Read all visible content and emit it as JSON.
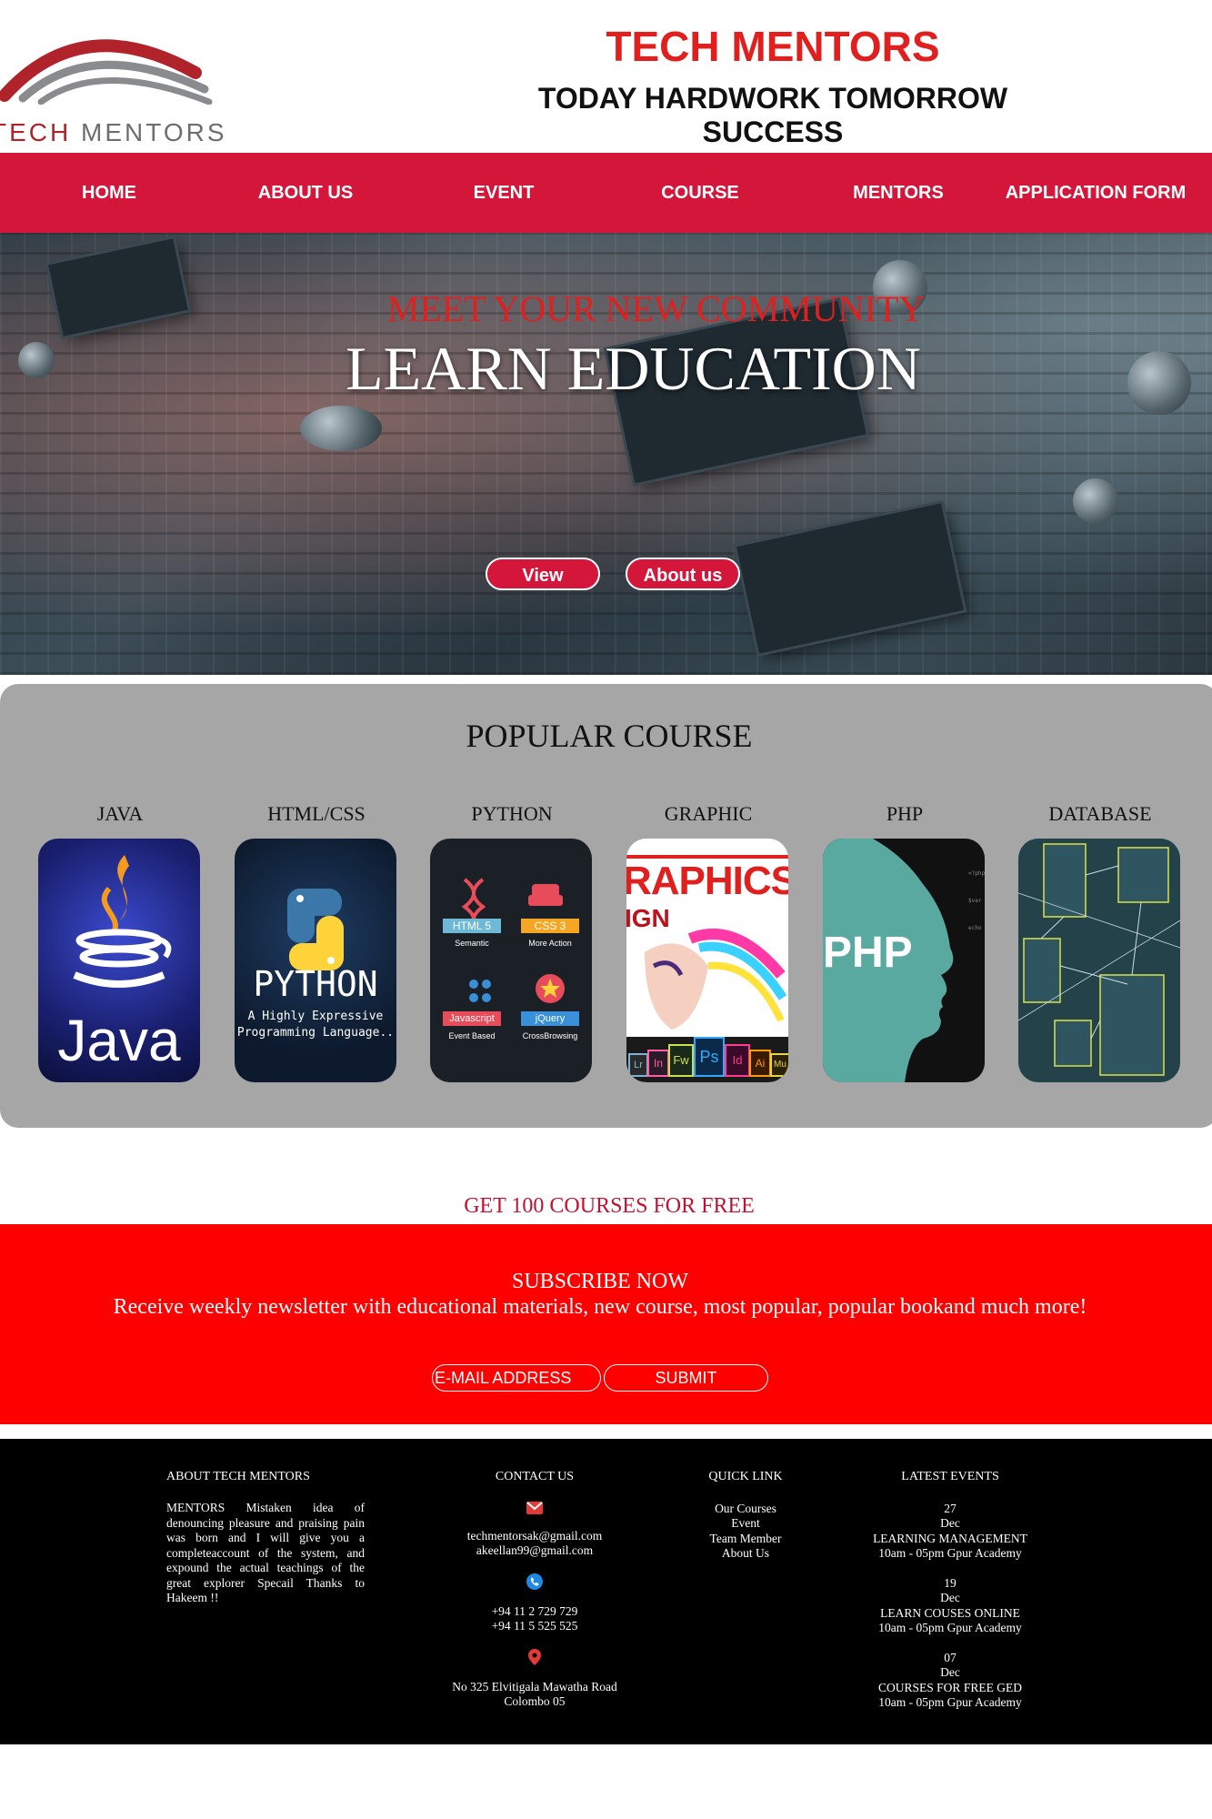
{
  "header": {
    "logo_text_accent": "TECH",
    "logo_text_rest": "MENTORS",
    "title": "TECH MENTORS",
    "tagline": "TODAY HARDWORK TOMORROW SUCCESS"
  },
  "nav": {
    "items": [
      "HOME",
      "ABOUT US",
      "EVENT",
      "COURSE",
      "MENTORS",
      "APPLICATION FORM"
    ]
  },
  "hero": {
    "subtitle": "MEET YOUR NEW COMMUNITY",
    "title": "LEARN EDUCATION",
    "buttons": [
      "View",
      "About us"
    ]
  },
  "popular": {
    "title": "POPULAR COURSE",
    "courses": [
      {
        "label": "JAVA",
        "card_text": "Java"
      },
      {
        "label": "HTML/CSS",
        "card_text": "PYTHON",
        "card_sub1": "A Highly Expressive",
        "card_sub2": "Programming Language.."
      },
      {
        "label": "PYTHON",
        "tiles": [
          "HTML 5",
          "CSS 3",
          "Javascript",
          "jQuery"
        ],
        "tile_subs": [
          "Semantic",
          "More Action",
          "Event Based",
          "CrossBrowsing"
        ]
      },
      {
        "label": "GRAPHIC",
        "card_text": "RAPHICS",
        "card_sub": "IGN",
        "app_icons": [
          "Lr",
          "In",
          "Fw",
          "Ps",
          "Id",
          "Ai",
          "Mu"
        ]
      },
      {
        "label": "PHP",
        "card_text": "PHP"
      },
      {
        "label": "DATABASE"
      }
    ]
  },
  "free_text": "GET 100 COURSES FOR FREE",
  "subscribe": {
    "title": "SUBSCRIBE NOW",
    "text": "Receive weekly newsletter with educational materials, new course, most popular, popular bookand much more!",
    "email_placeholder": "E-MAIL ADDRESS",
    "submit_label": "SUBMIT"
  },
  "footer": {
    "about": {
      "heading": "ABOUT TECH MENTORS",
      "text": "MENTORS Mistaken idea of denouncing pleasure and praising pain was born and I will give you a completeaccount of the system, and expound the actual teachings of the great explorer Specail Thanks to Hakeem !!"
    },
    "contact": {
      "heading": "CONTACT US",
      "emails": [
        "techmentorsak@gmail.com",
        "akeellan99@gmail.com"
      ],
      "phones": [
        "+94 11 2 729 729",
        "+94 11 5 525 525"
      ],
      "address": [
        "No 325 Elvitigala Mawatha Road",
        "Colombo 05"
      ]
    },
    "quick_links": {
      "heading": "QUICK LINK",
      "items": [
        "Our Courses",
        "Event",
        "Team Member",
        "About Us"
      ]
    },
    "events": {
      "heading": "LATEST EVENTS",
      "items": [
        {
          "day": "27",
          "month": "Dec",
          "title": "LEARNING MANAGEMENT",
          "time": "10am - 05pm Gpur Academy"
        },
        {
          "day": "19",
          "month": "Dec",
          "title": "LEARN COUSES ONLINE",
          "time": "10am - 05pm Gpur Academy"
        },
        {
          "day": "07",
          "month": "Dec",
          "title": "COURSES FOR FREE GED",
          "time": "10am - 05pm Gpur Academy"
        }
      ]
    }
  },
  "colors": {
    "brand_red": "#e0201f",
    "nav_red": "#d4163a",
    "subscribe_red": "#ff0000",
    "popular_gray": "#a6a6a6",
    "footer_black": "#000000"
  }
}
